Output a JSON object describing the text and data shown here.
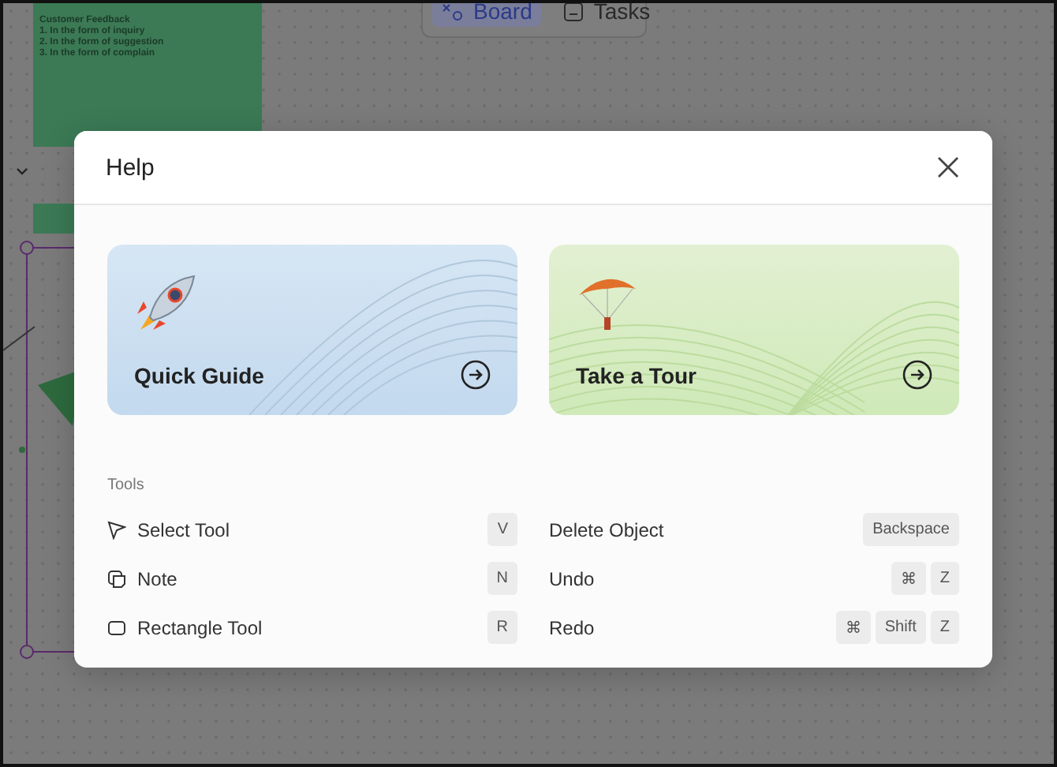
{
  "canvas": {
    "note": {
      "title": "Customer Feedback",
      "lines": [
        "1. In the form of inquiry",
        "2. In the form of suggestion",
        "3. In the form of complain"
      ]
    },
    "toolbar": [
      {
        "label": "Board",
        "selected": true
      },
      {
        "label": "Tasks",
        "selected": false
      }
    ]
  },
  "modal": {
    "title": "Help",
    "cards": [
      {
        "kind": "guide",
        "label": "Quick Guide"
      },
      {
        "kind": "tour",
        "label": "Take a Tour"
      }
    ],
    "section": "Tools",
    "shortcuts": [
      {
        "kind": "pointer",
        "label": "Select Tool",
        "keys": [
          "V"
        ]
      },
      {
        "kind": "action",
        "label": "Delete Object",
        "keys": [
          "Backspace"
        ]
      },
      {
        "kind": "note",
        "label": "Note",
        "keys": [
          "N"
        ]
      },
      {
        "kind": "action",
        "label": "Undo",
        "keys": [
          "⌘",
          "Z"
        ]
      },
      {
        "kind": "rect",
        "label": "Rectangle Tool",
        "keys": [
          "R"
        ]
      },
      {
        "kind": "action",
        "label": "Redo",
        "keys": [
          "⌘",
          "Shift",
          "Z"
        ]
      }
    ]
  }
}
